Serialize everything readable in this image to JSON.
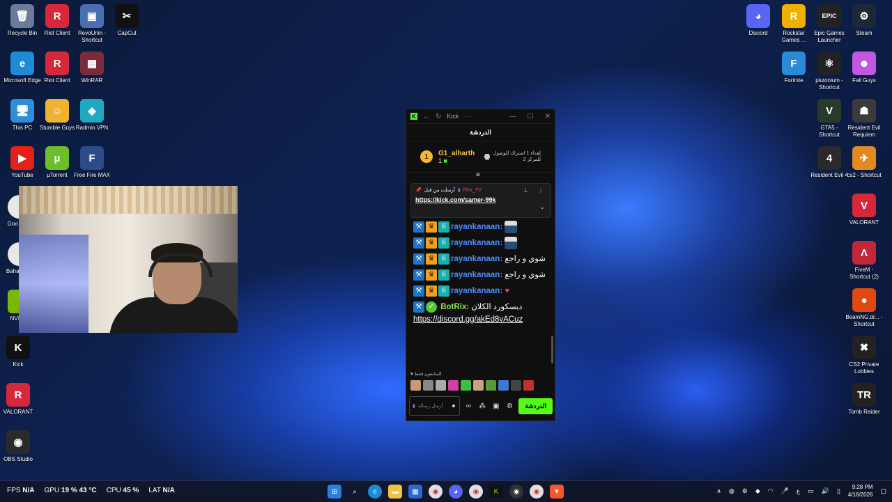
{
  "desktop_left": [
    {
      "label": "Recycle Bin",
      "color": "#6b7c99",
      "glyph": "🗑"
    },
    {
      "label": "Riot Client",
      "color": "#d6283a",
      "glyph": "R"
    },
    {
      "label": "RevoUnin - Shortcut",
      "color": "#4a6fb0",
      "glyph": "▣"
    },
    {
      "label": "CapCut",
      "color": "#111111",
      "glyph": "✂"
    },
    {
      "label": "Microsoft Edge",
      "color": "#1f8ad6",
      "glyph": "e"
    },
    {
      "label": "Riot Client",
      "color": "#d6283a",
      "glyph": "R"
    },
    {
      "label": "WinRAR",
      "color": "#7a2a3a",
      "glyph": "▦"
    },
    {
      "label": "This PC",
      "color": "#2d8fd6",
      "glyph": "🖥"
    },
    {
      "label": "Stumble Guys",
      "color": "#f0b030",
      "glyph": "☺"
    },
    {
      "label": "Radmin VPN",
      "color": "#20a8c0",
      "glyph": "◈"
    },
    {
      "label": "YouTube",
      "color": "#e62117",
      "glyph": "▶"
    },
    {
      "label": "µTorrent",
      "color": "#6cbf2a",
      "glyph": "µ"
    },
    {
      "label": "Free Fire MAX",
      "color": "#2d4a8a",
      "glyph": "F"
    },
    {
      "label": "Kick",
      "color": "#111111",
      "glyph": "K"
    },
    {
      "label": "VALORANT",
      "color": "#d6283a",
      "glyph": "R"
    },
    {
      "label": "OBS Studio",
      "color": "#2a2a2a",
      "glyph": "◉"
    }
  ],
  "partial_left_labels": [
    "Goo Chro",
    "Baha Chro",
    "NVIDIA"
  ],
  "desktop_right": [
    {
      "label": "Discord",
      "color": "#5865f2",
      "glyph": "◕"
    },
    {
      "label": "Rockstar Games ...",
      "color": "#f0b000",
      "glyph": "R"
    },
    {
      "label": "Epic Games Launcher",
      "color": "#222222",
      "glyph": "EPIC"
    },
    {
      "label": "Steam",
      "color": "#1b2838",
      "glyph": "⚙"
    },
    {
      "label": "Fortnite",
      "color": "#2a8ad6",
      "glyph": "F"
    },
    {
      "label": "plutonium - Shortcut",
      "color": "#222222",
      "glyph": "⚛"
    },
    {
      "label": "Fall Guys",
      "color": "#c058e0",
      "glyph": "☻"
    },
    {
      "label": "GTA5 - Shortcut",
      "color": "#2a3a2a",
      "glyph": "V"
    },
    {
      "label": "Resident Evil Requiem",
      "color": "#3a3a3a",
      "glyph": "☗"
    },
    {
      "label": "Resident Evil 4",
      "color": "#2a2a2a",
      "glyph": "4"
    },
    {
      "label": "cs2 - Shortcut",
      "color": "#e08a20",
      "glyph": "✈"
    },
    {
      "label": "VALORANT",
      "color": "#d6283a",
      "glyph": "V"
    },
    {
      "label": "FiveM - Shortcut (2)",
      "color": "#c0283a",
      "glyph": "Λ"
    },
    {
      "label": "BeamNG.dr... - Shortcut",
      "color": "#e04a10",
      "glyph": "●"
    },
    {
      "label": "CS2 Private Lobbies",
      "color": "#222222",
      "glyph": "✖"
    },
    {
      "label": "Tomb Raider",
      "color": "#222222",
      "glyph": "TR"
    }
  ],
  "kick": {
    "title": "Kick",
    "header": "الدردشة",
    "leader": {
      "rank": "1",
      "name": "G1_alharth",
      "count": "1",
      "side_line1": "إهداء 1 اشتراك للوصول",
      "side_line2": "2 للمركز"
    },
    "pinned": {
      "label": "أرسلت من قبل",
      "user": "Flex_TV",
      "link": "https://kick.com/samer-99k"
    },
    "messages": [
      {
        "user": "rayankanaan",
        "text": "",
        "emote": true
      },
      {
        "user": "rayankanaan",
        "text": "",
        "emote": true
      },
      {
        "user": "rayankanaan",
        "text": "شوي و راجع",
        "emote": false
      },
      {
        "user": "rayankanaan",
        "text": "شوي و راجع",
        "emote": false
      },
      {
        "user": "rayankanaan",
        "text": "♥",
        "emote": false
      }
    ],
    "bot": {
      "user": "BotRix",
      "text": "ديسكورد الكلان",
      "link": "https://discord.gg/akEd8vACuz"
    },
    "emote_title": "المتابعون فقط",
    "input_placeholder": "أرسل رسالة",
    "send_label": "الدردشة"
  },
  "taskbar": {
    "fps_label": "FPS",
    "fps": "N/A",
    "gpu_label": "GPU",
    "gpu": "19 % 43 °C",
    "cpu_label": "CPU",
    "cpu": "45 %",
    "lat_label": "LAT",
    "lat": "N/A",
    "time": "9:28 PM",
    "date": "4/16/2026",
    "lang": "ع"
  }
}
